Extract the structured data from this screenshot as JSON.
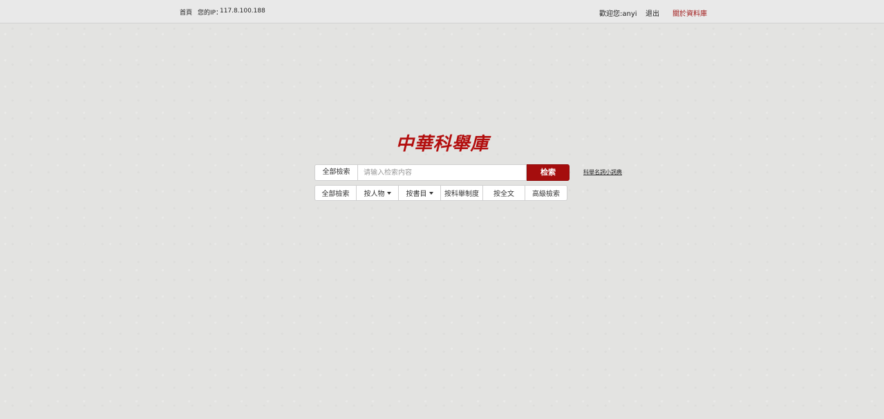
{
  "topbar": {
    "home": "首頁",
    "ip_label": "您的IP：",
    "ip_value": "117.8.100.188",
    "welcome": "歡迎您:anyi",
    "logout": "退出",
    "about": "關於資料庫"
  },
  "logo": {
    "text": "中華科舉庫"
  },
  "search": {
    "scope": "全部檢索",
    "placeholder": "请输入检索内容",
    "button": "检索",
    "dict_link": "科舉名詞小詞典"
  },
  "filters": [
    {
      "label": "全部檢索"
    },
    {
      "label": "按人物"
    },
    {
      "label": "按書目"
    },
    {
      "label": "按科舉制度"
    },
    {
      "label": "按全文"
    },
    {
      "label": "高級檢索"
    }
  ],
  "colors": {
    "accent": "#a50d0d",
    "about_link": "#a11a1a",
    "background": "#e3e3e1"
  }
}
